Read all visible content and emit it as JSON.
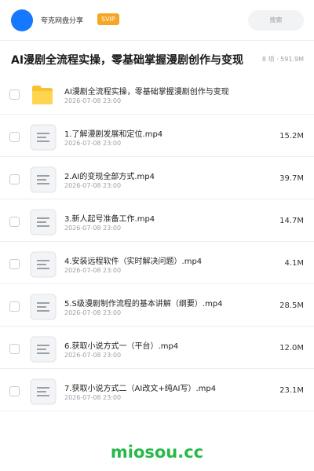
{
  "header": {
    "username": "夸克网盘分享",
    "badge": "SVIP",
    "search_placeholder": "搜索"
  },
  "share": {
    "title": "AI漫剧全流程实操，零基础掌握漫剧创作与变现",
    "summary": "8 项 · 591.9M"
  },
  "items": [
    {
      "type": "folder",
      "name": "AI漫剧全流程实操，零基础掌握漫剧创作与变现",
      "date": "2026-07-08 23:00",
      "size": ""
    },
    {
      "type": "file",
      "name": "1.了解漫剧发展和定位.mp4",
      "date": "2026-07-08 23:00",
      "size": "15.2M"
    },
    {
      "type": "file",
      "name": "2.AI的变现全部方式.mp4",
      "date": "2026-07-08 23:00",
      "size": "39.7M"
    },
    {
      "type": "file",
      "name": "3.新人起号准备工作.mp4",
      "date": "2026-07-08 23:00",
      "size": "14.7M"
    },
    {
      "type": "file",
      "name": "4.安装远程软件（实时解决问题）.mp4",
      "date": "2026-07-08 23:00",
      "size": "4.1M"
    },
    {
      "type": "file",
      "name": "5.S级漫剧制作流程的基本讲解（纲要）.mp4",
      "date": "2026-07-08 23:00",
      "size": "28.5M"
    },
    {
      "type": "file",
      "name": "6.获取小说方式一（平台）.mp4",
      "date": "2026-07-08 23:00",
      "size": "12.0M"
    },
    {
      "type": "file",
      "name": "7.获取小说方式二（AI改文+纯AI写）.mp4",
      "date": "2026-07-08 23:00",
      "size": "23.1M"
    }
  ],
  "watermark": "miosou.cc",
  "colors": {
    "accent": "#1677ff",
    "svip": "#f5a623",
    "folder": "#fbc02d",
    "watermark": "#27b84a"
  }
}
